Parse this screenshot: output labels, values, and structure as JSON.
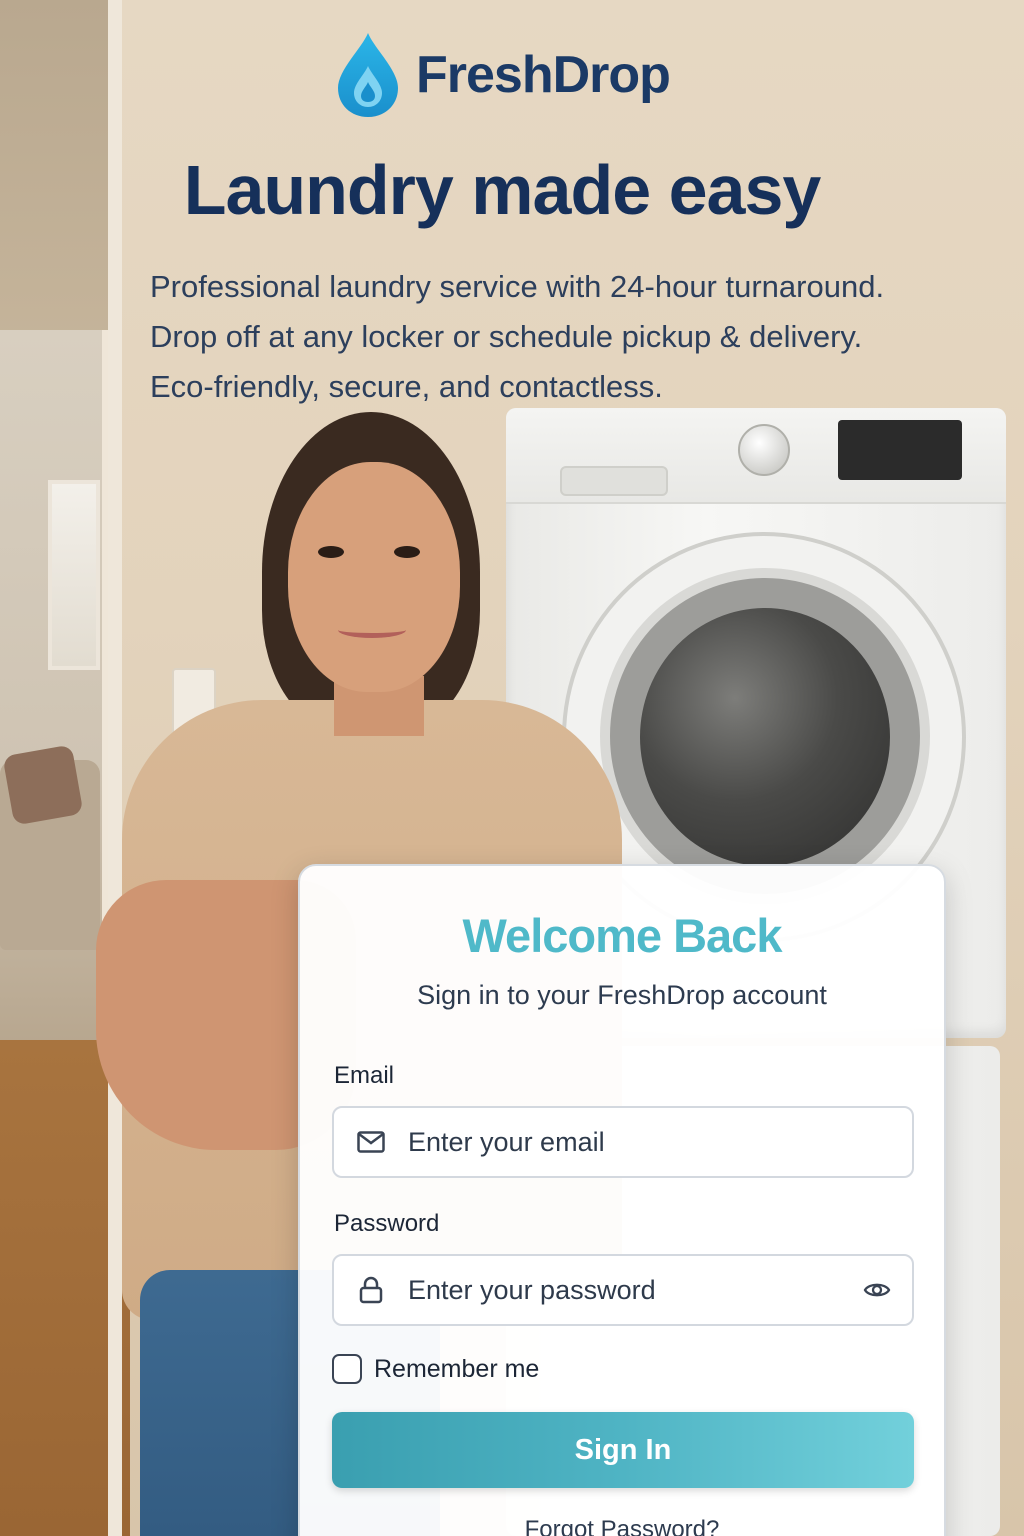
{
  "brand": {
    "name": "FreshDrop",
    "logo_icon": "water-drop-icon",
    "colors": {
      "logo": "#1aa3d9",
      "name": "#1b3a66"
    }
  },
  "hero": {
    "headline": "Laundry made easy",
    "description": [
      "Professional laundry service with 24-hour turnaround.",
      "Drop off at any locker or schedule pickup & delivery.",
      "Eco-friendly, secure, and contactless."
    ]
  },
  "login": {
    "title": "Welcome Back",
    "subtitle": "Sign in to your FreshDrop account",
    "email": {
      "label": "Email",
      "placeholder": "Enter your email",
      "value": "",
      "icon": "envelope-icon"
    },
    "password": {
      "label": "Password",
      "placeholder": "Enter your password",
      "value": "",
      "icon": "lock-icon",
      "toggle_icon": "eye-icon"
    },
    "remember_me": {
      "label": "Remember me",
      "checked": false
    },
    "submit_label": "Sign In",
    "forgot_label": "Forgot Password?",
    "colors": {
      "title": "#4fb9c9",
      "button_start": "#3a9fb0",
      "button_end": "#72d0db"
    }
  }
}
